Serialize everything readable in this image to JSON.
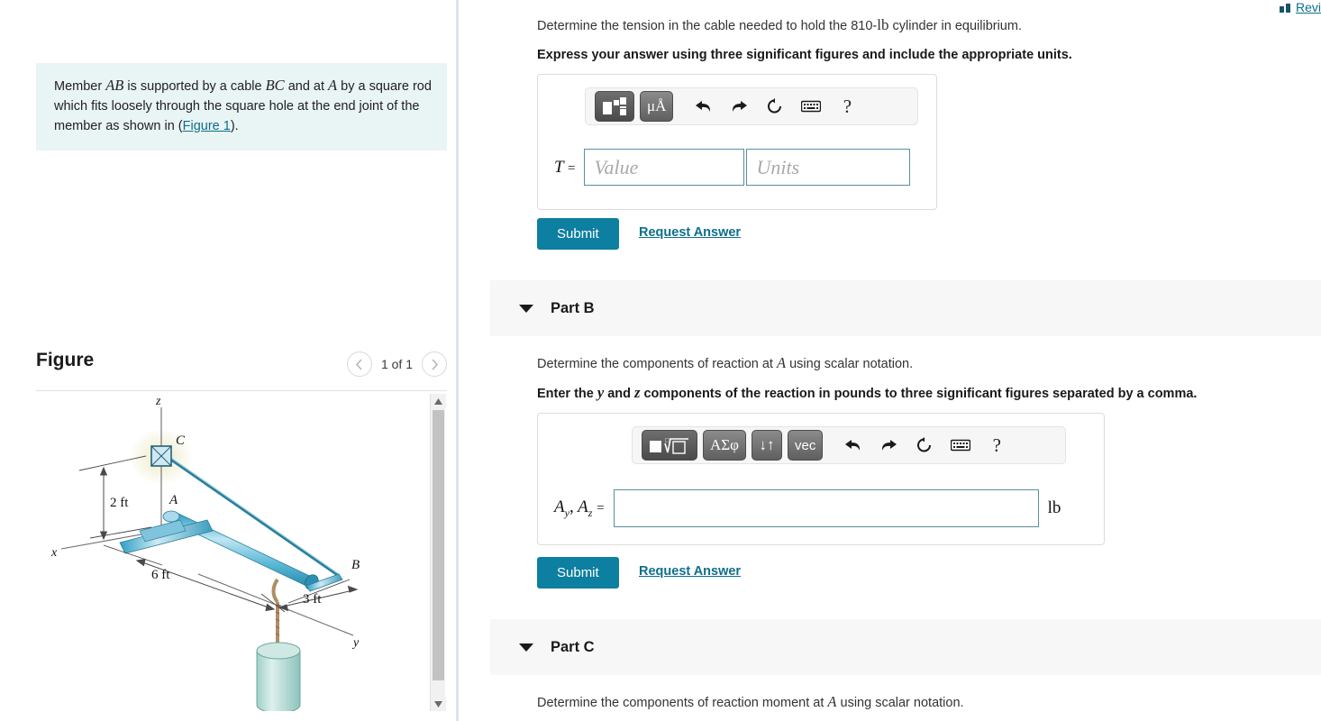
{
  "header": {
    "review_label": "Revi",
    "review_icon": "bar-chart-icon"
  },
  "left": {
    "intro": {
      "t1": "Member ",
      "m1": "AB",
      "t2": " is supported by a cable ",
      "m2": "BC",
      "t3": " and at ",
      "m3": "A",
      "t4": " by a square rod which fits loosely through the square hole at the end joint of the member as shown in (",
      "link": "Figure 1",
      "t5": ")."
    },
    "figure": {
      "title": "Figure",
      "pager_label": "1 of 1",
      "prev_icon": "chevron-left-icon",
      "next_icon": "chevron-right-icon",
      "labels": {
        "z": "z",
        "x": "x",
        "y": "y",
        "A": "A",
        "B": "B",
        "C": "C",
        "dim_2ft": "2 ft",
        "dim_6ft": "6 ft",
        "dim_3ft": "3 ft"
      }
    },
    "scrollbar": {
      "up_icon": "triangle-up-icon",
      "down_icon": "triangle-down-icon"
    }
  },
  "parts": [
    {
      "id": "A",
      "prompt_pre": "Determine the tension in the cable needed to hold the 810-",
      "prompt_unit": "lb",
      "prompt_post": " cylinder in equilibrium.",
      "instruction": "Express your answer using three significant figures and include the appropriate units.",
      "toolbar": [
        {
          "name": "math-template-button",
          "label": ""
        },
        {
          "name": "units-button",
          "label": "μÅ"
        },
        {
          "name": "undo-button",
          "label": "↶"
        },
        {
          "name": "redo-button",
          "label": "↷"
        },
        {
          "name": "reset-button",
          "label": "↻"
        },
        {
          "name": "keyboard-button",
          "label": "⌨"
        },
        {
          "name": "help-button",
          "label": "?"
        }
      ],
      "answer_label": "T",
      "answer_equals": "=",
      "value_placeholder": "Value",
      "units_placeholder": "Units",
      "value": "",
      "units": "",
      "submit_label": "Submit",
      "request_label": "Request Answer"
    },
    {
      "id": "B",
      "band_title": "Part B",
      "prompt_pre": "Determine the components of reaction at ",
      "prompt_var": "A",
      "prompt_post": " using scalar notation.",
      "instruction_pre": "Enter the ",
      "instruction_v1": "y",
      "instruction_mid": " and ",
      "instruction_v2": "z",
      "instruction_post": " components of the reaction in pounds to three significant figures separated by a comma.",
      "toolbar": [
        {
          "name": "math-template-button",
          "label": ""
        },
        {
          "name": "greek-symbols-button",
          "label": "ΑΣφ"
        },
        {
          "name": "arrows-button",
          "label": "↓↑"
        },
        {
          "name": "vector-button",
          "label": "vec"
        },
        {
          "name": "undo-button",
          "label": "↶"
        },
        {
          "name": "redo-button",
          "label": "↷"
        },
        {
          "name": "reset-button",
          "label": "↻"
        },
        {
          "name": "keyboard-button",
          "label": "⌨"
        },
        {
          "name": "help-button",
          "label": "?"
        }
      ],
      "answer_label_1": "A",
      "answer_sub_1": "y",
      "answer_comma": ",",
      "answer_label_2": "A",
      "answer_sub_2": "z",
      "answer_equals": "=",
      "value": "",
      "units_suffix": "lb",
      "submit_label": "Submit",
      "request_label": "Request Answer"
    },
    {
      "id": "C",
      "band_title": "Part C",
      "prompt_pre": "Determine the components of reaction moment at ",
      "prompt_var": "A",
      "prompt_post": " using scalar notation."
    }
  ],
  "colors": {
    "accent": "#0d7fa0",
    "link": "#0d6f8c",
    "intro_bg": "#e9f4f4",
    "band_bg": "#f7f7f7",
    "input_border": "#5a8f9c"
  }
}
